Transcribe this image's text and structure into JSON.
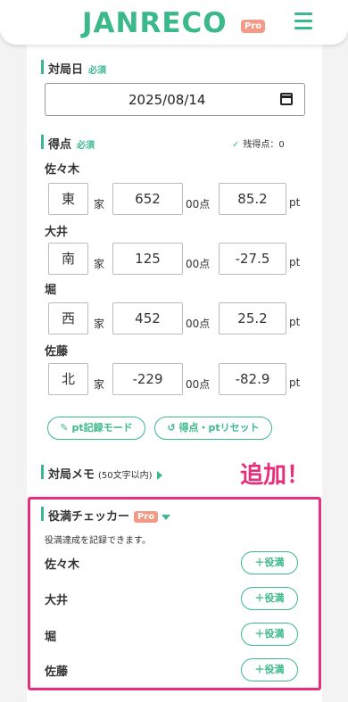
{
  "header": {
    "logo": "JANRECO",
    "pro_badge": "Pro"
  },
  "date_section": {
    "title": "対局日",
    "required": "必須",
    "value": "2025/08/14"
  },
  "score_section": {
    "title": "得点",
    "required": "必須",
    "remaining_check": "✓",
    "remaining": "残得点：0",
    "ie": "家",
    "hundreds_suffix": "00点",
    "pt_unit": "pt",
    "players": [
      {
        "name": "佐々木",
        "wind": "東",
        "score": "652",
        "pt": "85.2"
      },
      {
        "name": "大井",
        "wind": "南",
        "score": "125",
        "pt": "-27.5"
      },
      {
        "name": "堀",
        "wind": "西",
        "score": "452",
        "pt": "25.2"
      },
      {
        "name": "佐藤",
        "wind": "北",
        "score": "-229",
        "pt": "-82.9"
      }
    ],
    "pt_mode_button": "pt記録モード",
    "reset_button": "得点・ptリセット"
  },
  "memo_section": {
    "title": "対局メモ",
    "hint": "(50文字以内)"
  },
  "callout": "追加！",
  "yakuman_section": {
    "title": "役満チェッカー",
    "pro_badge": "Pro",
    "description": "役満達成を記録できます。",
    "button_label": "＋役満",
    "players": [
      "佐々木",
      "大井",
      "堀",
      "佐藤"
    ]
  },
  "colors": {
    "accent": "#3bb98a",
    "pro": "#f29a86",
    "highlight": "#e62e7a"
  }
}
